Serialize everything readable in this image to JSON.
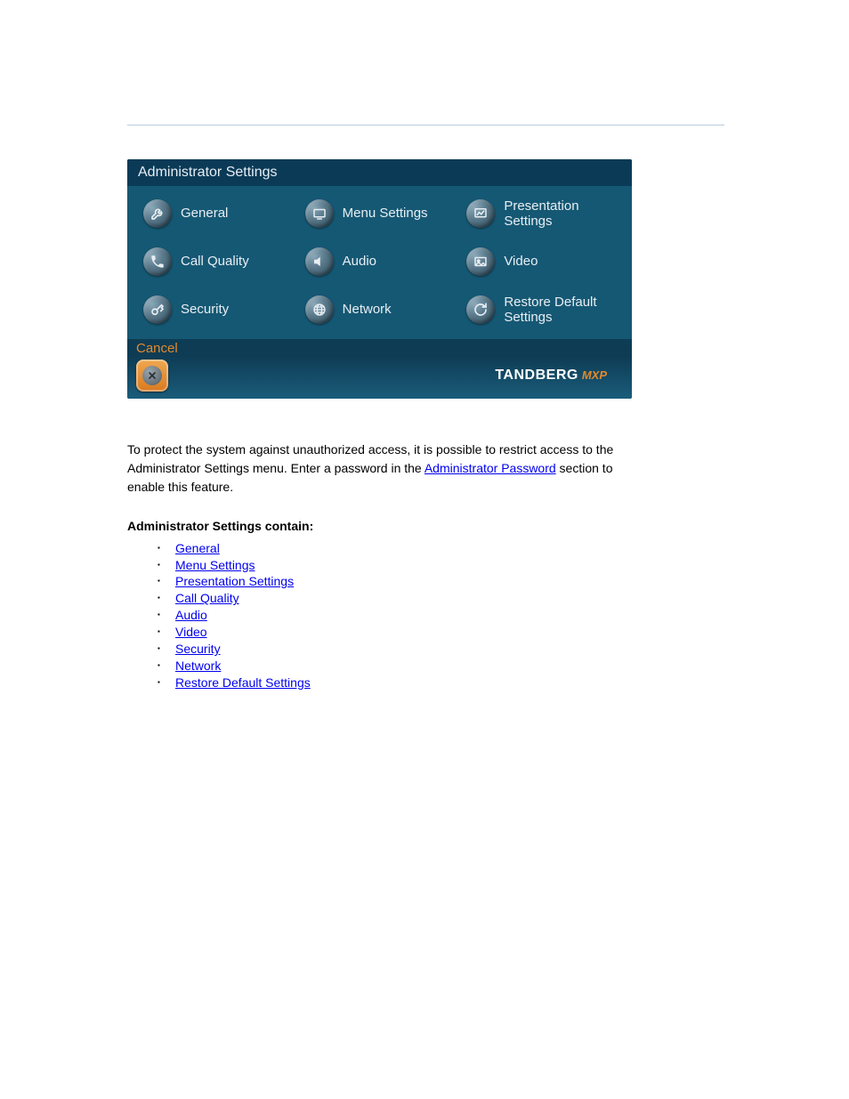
{
  "panel": {
    "title": "Administrator Settings",
    "items": [
      {
        "label": "General"
      },
      {
        "label": "Menu Settings"
      },
      {
        "label": "Presentation Settings"
      },
      {
        "label": "Call Quality"
      },
      {
        "label": "Audio"
      },
      {
        "label": "Video"
      },
      {
        "label": "Security"
      },
      {
        "label": "Network"
      },
      {
        "label": "Restore Default Settings"
      }
    ],
    "cancel_label": "Cancel",
    "brand_main": "TANDBERG",
    "brand_sub": "MXP"
  },
  "body": {
    "line1_prefix": "To protect the system against unauthorized access, it is possible to restrict access to the",
    "line2_prefix": "Administrator Settings menu. Enter a password in the ",
    "line2_link": "Administrator Password",
    "line2_suffix": " section to",
    "line3": "enable this feature."
  },
  "subheading": "Administrator Settings contain:",
  "links": [
    "General",
    "Menu Settings",
    "Presentation Settings",
    "Call Quality",
    "Audio",
    "Video",
    "Security",
    "Network",
    "Restore Default Settings"
  ]
}
